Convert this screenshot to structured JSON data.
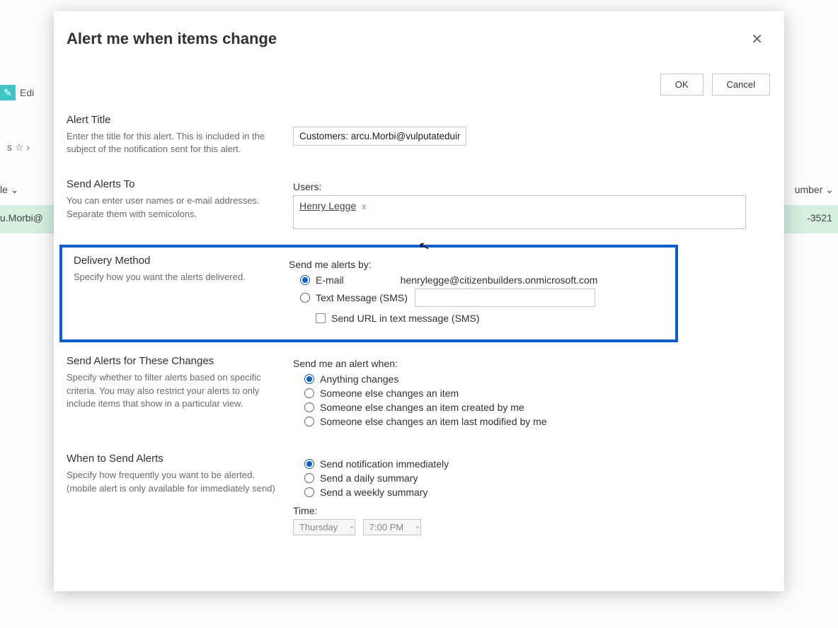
{
  "background": {
    "edit_label": "Edi",
    "star_row": "s  ☆  ›",
    "le_label": "le ⌄",
    "morbi": "u.Morbi@",
    "number_label": "umber ⌄",
    "num_3521": "-3521"
  },
  "modal": {
    "title": "Alert me when items change",
    "ok": "OK",
    "cancel": "Cancel"
  },
  "alert_title": {
    "heading": "Alert Title",
    "desc": "Enter the title for this alert. This is included in the subject of the notification sent for this alert.",
    "value": "Customers: arcu.Morbi@vulputateduinec."
  },
  "send_to": {
    "heading": "Send Alerts To",
    "desc": "You can enter user names or e-mail addresses. Separate them with semicolons.",
    "users_label": "Users:",
    "user_name": "Henry Legge",
    "remove_x": "x"
  },
  "delivery": {
    "heading": "Delivery Method",
    "desc": "Specify how you want the alerts delivered.",
    "send_by": "Send me alerts by:",
    "opt_email": "E-mail",
    "email_value": "henrylegge@citizenbuilders.onmicrosoft.com",
    "opt_sms": "Text Message (SMS)",
    "chk_url": "Send URL in text message (SMS)"
  },
  "changes": {
    "heading": "Send Alerts for These Changes",
    "desc": "Specify whether to filter alerts based on specific criteria. You may also restrict your alerts to only include items that show in a particular view.",
    "label": "Send me an alert when:",
    "opt1": "Anything changes",
    "opt2": "Someone else changes an item",
    "opt3": "Someone else changes an item created by me",
    "opt4": "Someone else changes an item last modified by me"
  },
  "when": {
    "heading": "When to Send Alerts",
    "desc": "Specify how frequently you want to be alerted. (mobile alert is only available for immediately send)",
    "opt1": "Send notification immediately",
    "opt2": "Send a daily summary",
    "opt3": "Send a weekly summary",
    "time_label": "Time:",
    "day": "Thursday",
    "hour": "7:00 PM"
  }
}
